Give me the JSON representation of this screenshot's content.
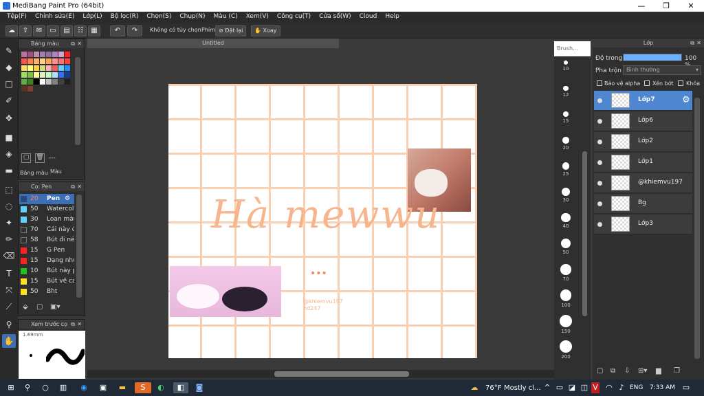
{
  "app": {
    "title": "MediBang Paint Pro (64bit)"
  },
  "window_controls": {
    "minimize": "—",
    "maximize": "❐",
    "close": "✕"
  },
  "menu": [
    "Tệp(F)",
    "Chỉnh sửa(E)",
    "Lớp(L)",
    "Bộ lọc(R)",
    "Chọn(S)",
    "Chụp(N)",
    "Màu (C)",
    "Xem(V)",
    "Công cụ(T)",
    "Cửa sổ(W)",
    "Cloud",
    "Help"
  ],
  "toolbar": {
    "no_option": "Không có tùy chọn",
    "key_label": "Phím",
    "reset_label": "Đặt lại",
    "rotate_label": "Xoay"
  },
  "color_panel": {
    "title": "Bảng màu",
    "tabs": [
      "Bảng màu",
      "Màu"
    ],
    "value": "---",
    "swatches": [
      "#c070a0",
      "#a05080",
      "#c08cb0",
      "#a080b0",
      "#9070a0",
      "#b080c0",
      "#d0a0d0",
      "#ff2020",
      "#ff5050",
      "#ff8050",
      "#ffb070",
      "#ffd080",
      "#ffa050",
      "#ff9090",
      "#ff7070",
      "#ff4040",
      "#ffe060",
      "#ffff80",
      "#ffd040",
      "#d0e080",
      "#ffb0b0",
      "#f06060",
      "#60d0ff",
      "#2090ff",
      "#a0e060",
      "#80c040",
      "#ffffa0",
      "#e0f0c0",
      "#c0ffc0",
      "#b0e0ff",
      "#3070ff",
      "#104090",
      "#60b040",
      "#408020",
      "#000000",
      "#ffffff",
      "#c0c0c0",
      "#808080",
      "#404040",
      "#202020",
      "#603020",
      "#804030"
    ]
  },
  "brush_panel": {
    "title": "Cọ: Pen",
    "brushes": [
      {
        "size": "20",
        "name": "Pen",
        "color": "#2a4a7a",
        "selected": true
      },
      {
        "size": "50",
        "name": "Watercol",
        "color": "#60d0ff"
      },
      {
        "size": "30",
        "name": "Loan màu",
        "color": "#60d0ff"
      },
      {
        "size": "70",
        "name": "Cái này đ",
        "color": "#303030"
      },
      {
        "size": "58",
        "name": "Bút đi né",
        "color": "#303030"
      },
      {
        "size": "15",
        "name": "G Pen",
        "color": "#ff2020"
      },
      {
        "size": "15",
        "name": "Dạng nhu",
        "color": "#ff2020"
      },
      {
        "size": "10",
        "name": "Bút này p",
        "color": "#20c020"
      },
      {
        "size": "15",
        "name": "Bút vẽ ca",
        "color": "#ffe020"
      },
      {
        "size": "50",
        "name": "Bht",
        "color": "#ffe020"
      }
    ]
  },
  "preview_panel": {
    "title": "Xem trước cọ",
    "size": "1.69mm"
  },
  "document": {
    "tab": "Untitled"
  },
  "canvas": {
    "title_text": "Hà mewwu",
    "dots": "•••",
    "credit1": "@khiemvu197",
    "credit2": "hd247"
  },
  "brush_sizes": {
    "title": "Brush...",
    "values": [
      "10",
      "12",
      "15",
      "20",
      "25",
      "30",
      "40",
      "50",
      "70",
      "100",
      "150",
      "200"
    ]
  },
  "layers_panel": {
    "title": "Lớp",
    "opacity_label": "Độ trong",
    "opacity_value": "100 %",
    "opacity_fraction": 1.0,
    "blend_label": "Pha trộn",
    "blend_value": "Bình thường",
    "protect_alpha": "Bảo vệ alpha",
    "clipping": "Xén bớt",
    "lock": "Khóa",
    "layers": [
      {
        "name": "Lớp7",
        "selected": true
      },
      {
        "name": "Lớp6"
      },
      {
        "name": "Lớp2"
      },
      {
        "name": "Lớp1"
      },
      {
        "name": "@khiemvu197"
      },
      {
        "name": "Bg"
      },
      {
        "name": "Lớp3"
      }
    ]
  },
  "taskbar": {
    "weather": "76°F",
    "weather_desc": "Mostly cl...",
    "lang": "ENG",
    "time": "7:33 AM"
  },
  "colors": {
    "accent": "#4e86d0",
    "grid": "#f8cfb0",
    "title_text": "#f6b58c"
  }
}
